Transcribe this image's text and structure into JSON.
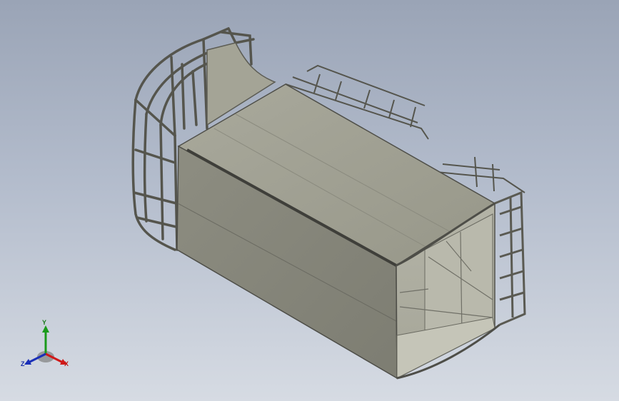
{
  "viewport": {
    "background_top": "#9aa4b6",
    "background_bottom": "#d6dbe3",
    "model_color": "#8e8e82",
    "frame_color": "#5c5c54"
  },
  "triad": {
    "x_label": "X",
    "y_label": "Y",
    "z_label": "Z",
    "x_color": "#c01818",
    "y_color": "#1a7a1a",
    "z_color": "#1a2fa8"
  }
}
